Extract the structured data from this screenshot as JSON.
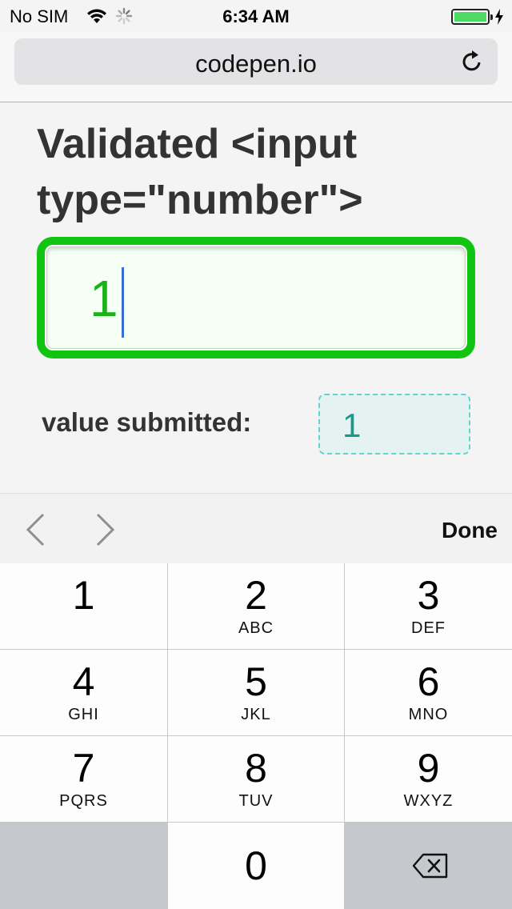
{
  "status_bar": {
    "carrier": "No SIM",
    "time": "6:34 AM",
    "battery_level": 1.0,
    "charging": true
  },
  "browser": {
    "url": "codepen.io",
    "reload_icon": "reload-icon"
  },
  "page": {
    "title": "Validated <input type=\"number\">",
    "input_value": "1",
    "submitted_label": "value submitted:",
    "submitted_value": "1",
    "colors": {
      "valid_border": "#11c411",
      "input_text": "#17b317",
      "submitted_text": "#1a9988",
      "submitted_border": "#62d4cc"
    }
  },
  "accessory": {
    "prev_icon": "chevron-left-icon",
    "next_icon": "chevron-right-icon",
    "done_label": "Done"
  },
  "keypad": {
    "keys": [
      {
        "digit": "1",
        "letters": ""
      },
      {
        "digit": "2",
        "letters": "ABC"
      },
      {
        "digit": "3",
        "letters": "DEF"
      },
      {
        "digit": "4",
        "letters": "GHI"
      },
      {
        "digit": "5",
        "letters": "JKL"
      },
      {
        "digit": "6",
        "letters": "MNO"
      },
      {
        "digit": "7",
        "letters": "PQRS"
      },
      {
        "digit": "8",
        "letters": "TUV"
      },
      {
        "digit": "9",
        "letters": "WXYZ"
      },
      {
        "digit": "0",
        "letters": ""
      }
    ],
    "delete_icon": "backspace-icon"
  }
}
